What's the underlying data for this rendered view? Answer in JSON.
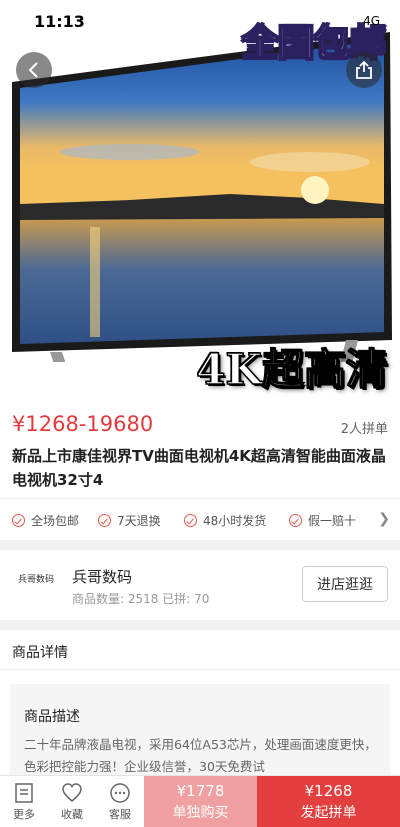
{
  "status": {
    "time": "11:13",
    "network": "4G"
  },
  "hero": {
    "overlay_top": "全国包邮",
    "overlay_bottom": "4K超高清"
  },
  "product": {
    "price_range": "¥1268-19680",
    "group_size": "2人拼单",
    "title": "新品上市康佳视界TV曲面电视机4K超高清智能曲面液晶电视机32寸4"
  },
  "guarantees": [
    "全场包邮",
    "7天退换",
    "48小时发货",
    "假一赔十"
  ],
  "shop": {
    "logo_text": "兵哥数码",
    "name": "兵哥数码",
    "stats": "商品数量: 2518  已拼: 70",
    "enter_button": "进店逛逛"
  },
  "details": {
    "header": "商品详情",
    "desc_title": "商品描述",
    "desc_text": "二十年品牌液晶电视，采用64位A53芯片，处理画面速度更快，色彩把控能力强！企业级信誉，30天免费试"
  },
  "bottom_bar": {
    "more": "更多",
    "favorite": "收藏",
    "service": "客服",
    "solo_price": "¥1778",
    "solo_label": "单独购买",
    "group_price": "¥1268",
    "group_label": "发起拼单"
  },
  "colors": {
    "accent": "#e33b3b",
    "solo_button": "#f0a0a0",
    "group_button": "#e33f3f"
  }
}
